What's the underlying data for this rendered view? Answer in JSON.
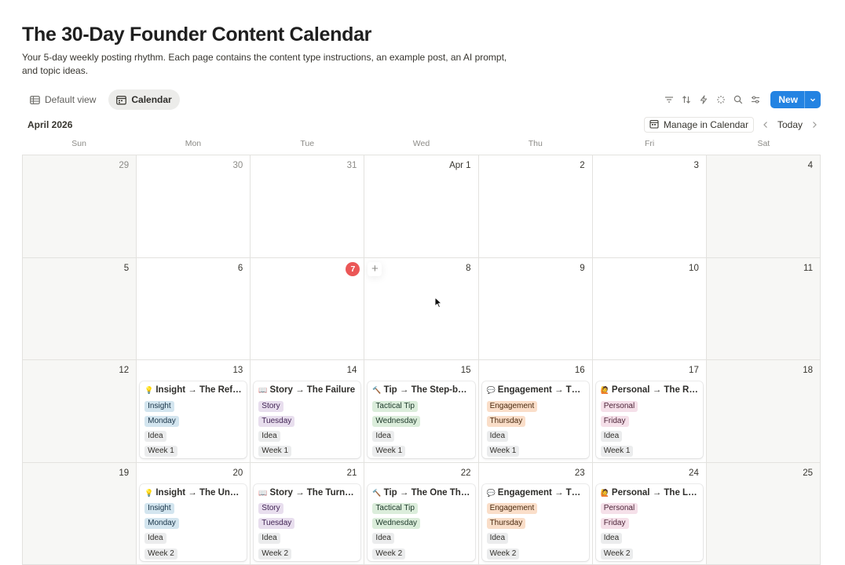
{
  "page": {
    "title": "The 30-Day Founder Content Calendar",
    "description": "Your 5-day weekly posting rhythm. Each page contains the content type instructions, an example post, an AI prompt, and topic ideas."
  },
  "views": [
    {
      "label": "Default view",
      "icon": "table-icon",
      "active": false
    },
    {
      "label": "Calendar",
      "icon": "calendar-icon",
      "active": true
    }
  ],
  "toolbar": {
    "icons": [
      "filter-icon",
      "sort-icon",
      "automation-icon",
      "ai-sparkle-icon",
      "search-icon",
      "settings-icon"
    ],
    "new_label": "New"
  },
  "calendar": {
    "month_label": "April 2026",
    "manage_label": "Manage in Calendar",
    "today_label": "Today",
    "weekdays": [
      "Sun",
      "Mon",
      "Tue",
      "Wed",
      "Thu",
      "Fri",
      "Sat"
    ],
    "today": "7",
    "weeks": [
      [
        "29",
        "30",
        "31",
        "Apr 1",
        "2",
        "3",
        "4"
      ],
      [
        "5",
        "6",
        "7",
        "8",
        "9",
        "10",
        "11"
      ],
      [
        "12",
        "13",
        "14",
        "15",
        "16",
        "17",
        "18"
      ],
      [
        "19",
        "20",
        "21",
        "22",
        "23",
        "24",
        "25"
      ]
    ],
    "muted_days": [
      "29",
      "30",
      "31"
    ]
  },
  "tag_colors": {
    "Insight": {
      "bg": "#d3e5ef",
      "fg": "#183347"
    },
    "Monday": {
      "bg": "#d3e5ef",
      "fg": "#183347"
    },
    "Story": {
      "bg": "#e8deee",
      "fg": "#412454"
    },
    "Tuesday": {
      "bg": "#e8deee",
      "fg": "#412454"
    },
    "Tactical Tip": {
      "bg": "#dbeddb",
      "fg": "#1c3829"
    },
    "Wednesday": {
      "bg": "#dbeddb",
      "fg": "#1c3829"
    },
    "Engagement": {
      "bg": "#fadec9",
      "fg": "#49290e"
    },
    "Thursday": {
      "bg": "#fadec9",
      "fg": "#49290e"
    },
    "Personal": {
      "bg": "#f5e0e9",
      "fg": "#4c2337"
    },
    "Friday": {
      "bg": "#f5e0e9",
      "fg": "#4c2337"
    },
    "Idea": {
      "bg": "#ebeced",
      "fg": "#32302c"
    },
    "Week 1": {
      "bg": "#ebeced",
      "fg": "#32302c"
    },
    "Week 2": {
      "bg": "#ebeced",
      "fg": "#32302c"
    }
  },
  "events": [
    {
      "week": 2,
      "day": 1,
      "emoji": "💡",
      "title": "Insight → The Reframe",
      "tags": [
        "Insight",
        "Monday",
        "Idea",
        "Week 1"
      ]
    },
    {
      "week": 2,
      "day": 2,
      "emoji": "📖",
      "title": "Story → The Failure",
      "tags": [
        "Story",
        "Tuesday",
        "Idea",
        "Week 1"
      ]
    },
    {
      "week": 2,
      "day": 3,
      "emoji": "🔨",
      "title": "Tip → The Step-by-Step",
      "tags": [
        "Tactical Tip",
        "Wednesday",
        "Idea",
        "Week 1"
      ]
    },
    {
      "week": 2,
      "day": 4,
      "emoji": "💬",
      "title": "Engagement → The Question",
      "tags": [
        "Engagement",
        "Thursday",
        "Idea",
        "Week 1"
      ]
    },
    {
      "week": 2,
      "day": 5,
      "emoji": "🙋",
      "title": "Personal → The Routine",
      "tags": [
        "Personal",
        "Friday",
        "Idea",
        "Week 1"
      ]
    },
    {
      "week": 3,
      "day": 1,
      "emoji": "💡",
      "title": "Insight → The Uncomfortable Truth",
      "tags": [
        "Insight",
        "Monday",
        "Idea",
        "Week 2"
      ]
    },
    {
      "week": 3,
      "day": 2,
      "emoji": "📖",
      "title": "Story → The Turning Point",
      "tags": [
        "Story",
        "Tuesday",
        "Idea",
        "Week 2"
      ]
    },
    {
      "week": 3,
      "day": 3,
      "emoji": "🔨",
      "title": "Tip → The One Thing",
      "tags": [
        "Tactical Tip",
        "Wednesday",
        "Idea",
        "Week 2"
      ]
    },
    {
      "week": 3,
      "day": 4,
      "emoji": "💬",
      "title": "Engagement → The Hot Take",
      "tags": [
        "Engagement",
        "Thursday",
        "Idea",
        "Week 2"
      ]
    },
    {
      "week": 3,
      "day": 5,
      "emoji": "🙋",
      "title": "Personal → The Lesson",
      "tags": [
        "Personal",
        "Friday",
        "Idea",
        "Week 2"
      ]
    }
  ]
}
